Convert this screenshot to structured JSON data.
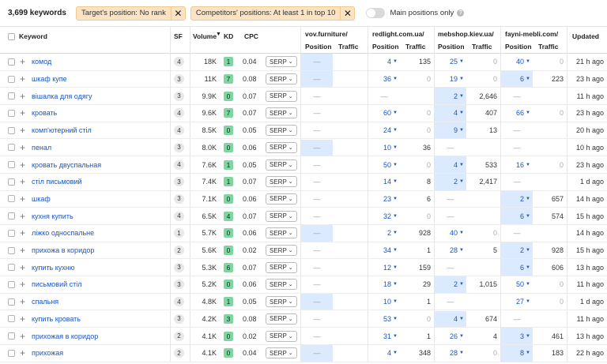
{
  "topbar": {
    "keyword_count": "3,699 keywords",
    "filters": [
      {
        "label": "Target's position: No rank"
      },
      {
        "label": "Competitors' positions: At least 1 in top 10"
      }
    ],
    "toggle_label": "Main positions only",
    "help_glyph": "?"
  },
  "table": {
    "headers": {
      "keyword": "Keyword",
      "sf": "SF",
      "volume": "Volume",
      "kd": "KD",
      "cpc": "CPC",
      "updated": "Updated",
      "position": "Position",
      "traffic": "Traffic"
    },
    "competitors": [
      "vov.furniture/",
      "redlight.com.ua/",
      "mebshop.kiev.ua/",
      "fayni-mebli.com/"
    ],
    "rows": [
      {
        "keyword": "комод",
        "sf": "4",
        "volume": "18K",
        "kd": "1",
        "cpc": "0.04",
        "serp": "SERP",
        "c": [
          [
            "—",
            ""
          ],
          [
            "4",
            "135"
          ],
          [
            "25",
            "0"
          ],
          [
            "40",
            "0"
          ]
        ],
        "hl": [
          1,
          0,
          0,
          0
        ],
        "updated": "21 h ago"
      },
      {
        "keyword": "шкаф купе",
        "sf": "3",
        "volume": "11K",
        "kd": "7",
        "cpc": "0.08",
        "serp": "SERP",
        "c": [
          [
            "—",
            ""
          ],
          [
            "36",
            "0"
          ],
          [
            "19",
            "0"
          ],
          [
            "6",
            "223"
          ]
        ],
        "hl": [
          1,
          0,
          0,
          1
        ],
        "updated": "23 h ago"
      },
      {
        "keyword": "вішалка для одягу",
        "sf": "3",
        "volume": "9.9K",
        "kd": "0",
        "cpc": "0.07",
        "serp": "SERP",
        "c": [
          [
            "—",
            ""
          ],
          [
            "—",
            ""
          ],
          [
            "2",
            "2,646"
          ],
          [
            "—",
            ""
          ]
        ],
        "hl": [
          0,
          0,
          1,
          0
        ],
        "updated": "11 h ago"
      },
      {
        "keyword": "кровать",
        "sf": "4",
        "volume": "9.6K",
        "kd": "7",
        "cpc": "0.07",
        "serp": "SERP",
        "c": [
          [
            "—",
            ""
          ],
          [
            "60",
            "0"
          ],
          [
            "4",
            "407"
          ],
          [
            "66",
            "0"
          ]
        ],
        "hl": [
          0,
          0,
          1,
          0
        ],
        "updated": "23 h ago"
      },
      {
        "keyword": "комп'ютерний стіл",
        "sf": "4",
        "volume": "8.5K",
        "kd": "0",
        "cpc": "0.05",
        "serp": "SERP",
        "c": [
          [
            "—",
            ""
          ],
          [
            "24",
            "0"
          ],
          [
            "9",
            "13"
          ],
          [
            "—",
            ""
          ]
        ],
        "hl": [
          0,
          0,
          1,
          0
        ],
        "updated": "20 h ago"
      },
      {
        "keyword": "пенал",
        "sf": "3",
        "volume": "8.0K",
        "kd": "0",
        "cpc": "0.06",
        "serp": "SERP",
        "c": [
          [
            "—",
            ""
          ],
          [
            "10",
            "36"
          ],
          [
            "—",
            ""
          ],
          [
            "—",
            ""
          ]
        ],
        "hl": [
          1,
          0,
          0,
          0
        ],
        "updated": "10 h ago"
      },
      {
        "keyword": "кровать двуспальная",
        "sf": "4",
        "volume": "7.6K",
        "kd": "1",
        "cpc": "0.05",
        "serp": "SERP",
        "c": [
          [
            "—",
            ""
          ],
          [
            "50",
            "0"
          ],
          [
            "4",
            "533"
          ],
          [
            "16",
            "0"
          ]
        ],
        "hl": [
          0,
          0,
          1,
          0
        ],
        "updated": "23 h ago"
      },
      {
        "keyword": "стіл письмовий",
        "sf": "3",
        "volume": "7.4K",
        "kd": "1",
        "cpc": "0.07",
        "serp": "SERP",
        "c": [
          [
            "—",
            ""
          ],
          [
            "14",
            "8"
          ],
          [
            "2",
            "2,417"
          ],
          [
            "—",
            ""
          ]
        ],
        "hl": [
          0,
          0,
          1,
          0
        ],
        "updated": "1 d ago"
      },
      {
        "keyword": "шкаф",
        "sf": "3",
        "volume": "7.1K",
        "kd": "0",
        "cpc": "0.06",
        "serp": "SERP",
        "c": [
          [
            "—",
            ""
          ],
          [
            "23",
            "6"
          ],
          [
            "—",
            ""
          ],
          [
            "2",
            "657"
          ]
        ],
        "hl": [
          0,
          0,
          0,
          1
        ],
        "updated": "14 h ago"
      },
      {
        "keyword": "кухня купить",
        "sf": "4",
        "volume": "6.5K",
        "kd": "4",
        "cpc": "0.07",
        "serp": "SERP",
        "c": [
          [
            "—",
            ""
          ],
          [
            "32",
            "0"
          ],
          [
            "—",
            ""
          ],
          [
            "6",
            "574"
          ]
        ],
        "hl": [
          0,
          0,
          0,
          1
        ],
        "updated": "15 h ago"
      },
      {
        "keyword": "ліжко односпальне",
        "sf": "1",
        "volume": "5.7K",
        "kd": "0",
        "cpc": "0.06",
        "serp": "SERP",
        "c": [
          [
            "—",
            ""
          ],
          [
            "2",
            "928"
          ],
          [
            "40",
            "0"
          ],
          [
            "—",
            ""
          ]
        ],
        "hl": [
          1,
          0,
          0,
          0
        ],
        "updated": "14 h ago"
      },
      {
        "keyword": "прихожа в коридор",
        "sf": "2",
        "volume": "5.6K",
        "kd": "0",
        "cpc": "0.02",
        "serp": "SERP",
        "c": [
          [
            "—",
            ""
          ],
          [
            "34",
            "1"
          ],
          [
            "28",
            "5"
          ],
          [
            "2",
            "928"
          ]
        ],
        "hl": [
          0,
          0,
          0,
          1
        ],
        "updated": "15 h ago"
      },
      {
        "keyword": "купить кухню",
        "sf": "3",
        "volume": "5.3K",
        "kd": "6",
        "cpc": "0.07",
        "serp": "SERP",
        "c": [
          [
            "—",
            ""
          ],
          [
            "12",
            "159"
          ],
          [
            "—",
            ""
          ],
          [
            "6",
            "606"
          ]
        ],
        "hl": [
          0,
          0,
          0,
          1
        ],
        "updated": "13 h ago"
      },
      {
        "keyword": "письмовий стіл",
        "sf": "3",
        "volume": "5.2K",
        "kd": "0",
        "cpc": "0.06",
        "serp": "SERP",
        "c": [
          [
            "—",
            ""
          ],
          [
            "18",
            "29"
          ],
          [
            "2",
            "1,015"
          ],
          [
            "50",
            "0"
          ]
        ],
        "hl": [
          0,
          0,
          1,
          0
        ],
        "updated": "11 h ago"
      },
      {
        "keyword": "спальня",
        "sf": "4",
        "volume": "4.8K",
        "kd": "1",
        "cpc": "0.05",
        "serp": "SERP",
        "c": [
          [
            "—",
            ""
          ],
          [
            "10",
            "1"
          ],
          [
            "—",
            ""
          ],
          [
            "27",
            "0"
          ]
        ],
        "hl": [
          1,
          0,
          0,
          0
        ],
        "updated": "1 d ago"
      },
      {
        "keyword": "купить кровать",
        "sf": "3",
        "volume": "4.2K",
        "kd": "3",
        "cpc": "0.08",
        "serp": "SERP",
        "c": [
          [
            "—",
            ""
          ],
          [
            "53",
            "0"
          ],
          [
            "4",
            "674"
          ],
          [
            "—",
            ""
          ]
        ],
        "hl": [
          0,
          0,
          1,
          0
        ],
        "updated": "11 h ago"
      },
      {
        "keyword": "прихожая в коридор",
        "sf": "2",
        "volume": "4.1K",
        "kd": "0",
        "cpc": "0.02",
        "serp": "SERP",
        "c": [
          [
            "—",
            ""
          ],
          [
            "31",
            "1"
          ],
          [
            "26",
            "4"
          ],
          [
            "3",
            "461"
          ]
        ],
        "hl": [
          0,
          0,
          0,
          1
        ],
        "updated": "13 h ago"
      },
      {
        "keyword": "прихожая",
        "sf": "2",
        "volume": "4.1K",
        "kd": "0",
        "cpc": "0.04",
        "serp": "SERP",
        "c": [
          [
            "—",
            ""
          ],
          [
            "4",
            "348"
          ],
          [
            "28",
            "0"
          ],
          [
            "8",
            "183"
          ]
        ],
        "hl": [
          1,
          0,
          0,
          1
        ],
        "updated": "22 h ago"
      }
    ]
  },
  "colors": {
    "link": "#1a56c4",
    "highlight": "#dceaff",
    "kd_green": "#7fd69e",
    "chip": "#fbe3c4"
  }
}
